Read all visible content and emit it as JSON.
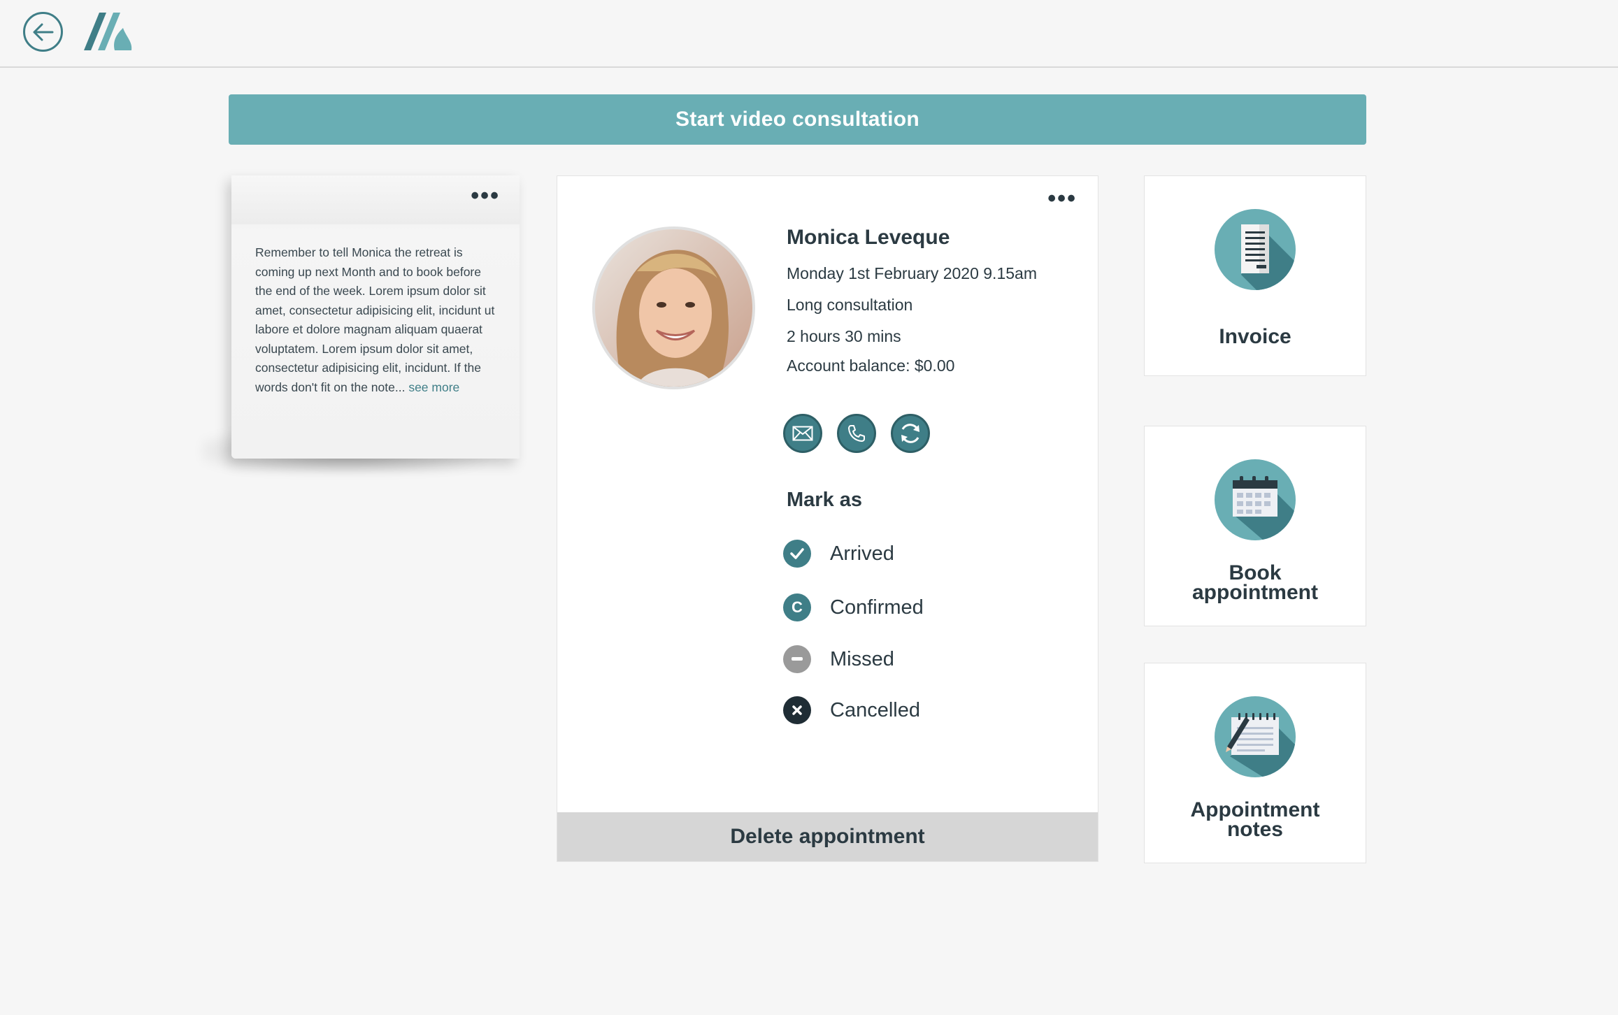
{
  "topbar": {
    "back_icon": "arrow-left-icon",
    "logo_icon": "brand-logo-icon"
  },
  "main": {
    "start_video_label": "Start video consultation"
  },
  "note": {
    "text": "Remember to tell Monica the retreat is coming up next Month and to book before the end of the week. Lorem ipsum dolor sit amet, consectetur adipisicing elit, incidunt ut labore et dolore magnam aliquam quaerat voluptatem. Lorem ipsum dolor sit amet, consectetur adipisicing elit,  incidunt. If the words don't fit on the note... ",
    "see_more": "see more",
    "menu_icon": "more-horizontal-icon"
  },
  "appointment": {
    "patient_name": "Monica Leveque",
    "datetime": "Monday 1st February 2020 9.15am",
    "type": "Long consultation",
    "duration": "2 hours 30 mins",
    "account_balance": "Account balance: $0.00",
    "contact_icons": [
      "email-icon",
      "phone-icon",
      "refresh-icon"
    ],
    "mark_as_title": "Mark as",
    "statuses": [
      {
        "label": "Arrived",
        "icon": "check-icon",
        "color": "#3f7e87"
      },
      {
        "label": "Confirmed",
        "icon": "c-icon",
        "color": "#3f7e87"
      },
      {
        "label": "Missed",
        "icon": "minus-icon",
        "color": "#9a9a9a"
      },
      {
        "label": "Cancelled",
        "icon": "x-icon",
        "color": "#1f2d35"
      }
    ],
    "delete_label": "Delete appointment",
    "menu_icon": "more-horizontal-icon"
  },
  "tiles": [
    {
      "label": "Invoice",
      "icon": "invoice-icon"
    },
    {
      "label": "Book appointment",
      "line1": "Book",
      "line2": "appointment",
      "icon": "calendar-icon"
    },
    {
      "label": "Appointment notes",
      "line1": "Appointment",
      "line2": "notes",
      "icon": "notepad-icon"
    }
  ],
  "colors": {
    "accent": "#69aeb4",
    "accent_dark": "#3f7e87",
    "text": "#2b3a42",
    "background": "#f6f6f6"
  }
}
